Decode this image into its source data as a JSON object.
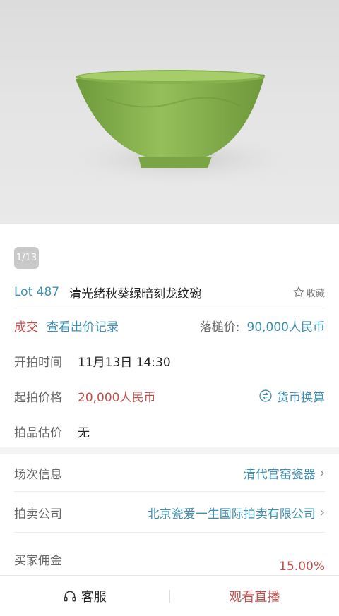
{
  "gallery": {
    "counter": "1/13"
  },
  "lot": {
    "number": "Lot 487",
    "title": "清光绪秋葵绿暗刻龙纹碗",
    "favorite_label": "收藏"
  },
  "status": {
    "result": "成交",
    "bid_record_link": "查看出价记录",
    "hammer_label": "落槌价:",
    "hammer_price": "90,000人民币"
  },
  "details": {
    "start_time_label": "开拍时间",
    "start_time": "11月13日 14:30",
    "start_price_label": "起拍价格",
    "start_price": "20,000人民币",
    "currency_label": "货币换算",
    "estimate_label": "拍品估价",
    "estimate": "无"
  },
  "info": {
    "session_label": "场次信息",
    "session_value": "清代官窑瓷器",
    "company_label": "拍卖公司",
    "company_value": "北京瓷爱一生国际拍卖有限公司",
    "commission_label": "买家佣金",
    "commission_value": "15.00%"
  },
  "bottom_bar": {
    "service_label": "客服",
    "live_label": "观看直播"
  },
  "colors": {
    "accent_blue": "#3f8fb0",
    "accent_red": "#c0504d"
  }
}
